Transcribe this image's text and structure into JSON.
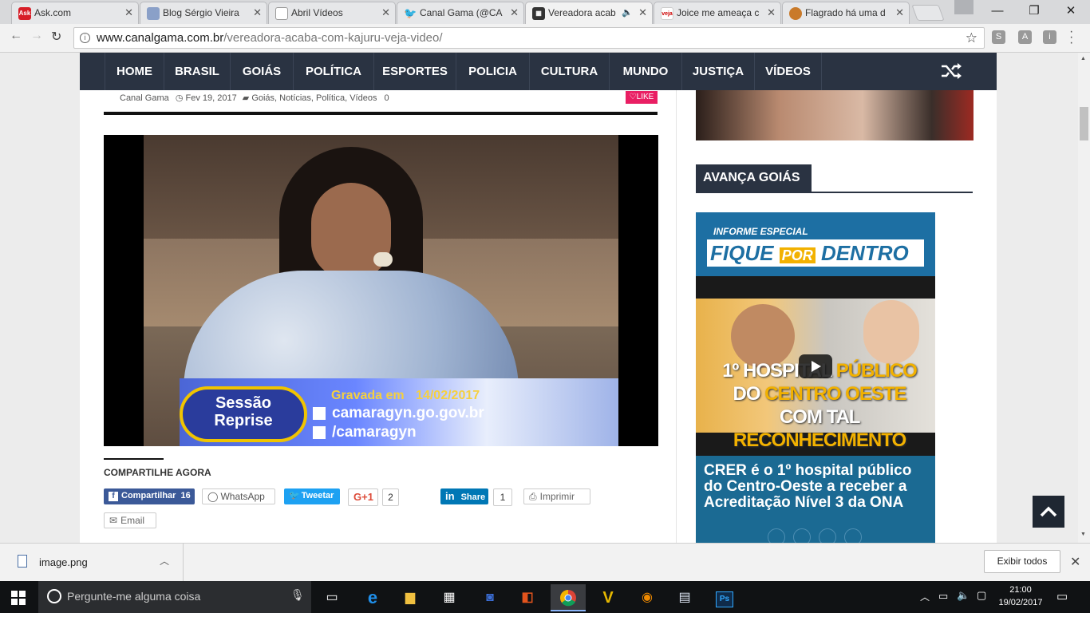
{
  "browser": {
    "tabs": [
      {
        "title": "Ask.com",
        "favicon": "ask-icon"
      },
      {
        "title": "Blog Sérgio Vieira",
        "favicon": "blog-icon"
      },
      {
        "title": "Abril Vídeos",
        "favicon": "page-icon"
      },
      {
        "title": "Canal Gama (@CA",
        "favicon": "twitter-icon"
      },
      {
        "title": "Vereadora acab",
        "favicon": "film-icon"
      },
      {
        "title": "Joice me ameaça c",
        "favicon": "veja-icon"
      },
      {
        "title": "Flagrado há uma d",
        "favicon": "news-icon"
      }
    ],
    "url_domain": "www.canalgama.com.br",
    "url_path": "/vereadora-acaba-com-kajuru-veja-video/",
    "ext_labels": [
      "S",
      "A",
      "i"
    ]
  },
  "nav": {
    "items": [
      "HOME",
      "BRASIL",
      "GOIÁS",
      "POLÍTICA",
      "ESPORTES",
      "POLICIA",
      "CULTURA",
      "MUNDO",
      "JUSTIÇA",
      "VÍDEOS"
    ]
  },
  "post": {
    "author": "Canal Gama",
    "date": "Fev 19, 2017",
    "categories": "Goiás, Notícias, Política, Vídeos",
    "comments": "0",
    "like_label": "LIKE"
  },
  "video": {
    "overlay_title_1": "Sessão",
    "overlay_title_2": "Reprise",
    "recorded_label": "Gravada em",
    "recorded_date": "14/02/2017",
    "site": "camaragyn.go.gov.br",
    "social": "/camaragyn"
  },
  "share": {
    "heading": "COMPARTILHE AGORA",
    "facebook_label": "Compartilhar",
    "facebook_count": "16",
    "whatsapp_label": "WhatsApp",
    "twitter_label": "Tweetar",
    "gplus_label": "G+1",
    "gplus_count": "2",
    "linkedin_label": "Share",
    "linkedin_count": "1",
    "print_label": "Imprimir",
    "email_label": "Email"
  },
  "sidebar": {
    "widget_title": "AVANÇA GOIÁS",
    "ad_kicker": "INFORME ESPECIAL",
    "ad_title_1": "FIQUE",
    "ad_title_2": "POR",
    "ad_title_3": "DENTRO",
    "ad_line_1a": "1º HOSPITAL",
    "ad_line_1b": "PÚBLICO",
    "ad_line_2a": "DO",
    "ad_line_2b": "CENTRO OESTE",
    "ad_line_3a": "COM TAL",
    "ad_line_3b": "RECONHECIMENTO",
    "ad_caption": "CRER é o 1º hospital público do Centro-Oeste a receber a Acreditação Nível 3 da ONA"
  },
  "download": {
    "filename": "image.png",
    "show_all": "Exibir todos"
  },
  "taskbar": {
    "search_placeholder": "Pergunte-me alguma coisa",
    "time": "21:00",
    "date": "19/02/2017"
  },
  "colors": {
    "nav_bg": "#2a3342",
    "like_pink": "#e91e63",
    "facebook": "#3b5998",
    "twitter": "#1da1f2",
    "linkedin": "#0077b5",
    "ad_blue": "#1d6fa3",
    "ad_caption_bg": "#1b6a93"
  }
}
